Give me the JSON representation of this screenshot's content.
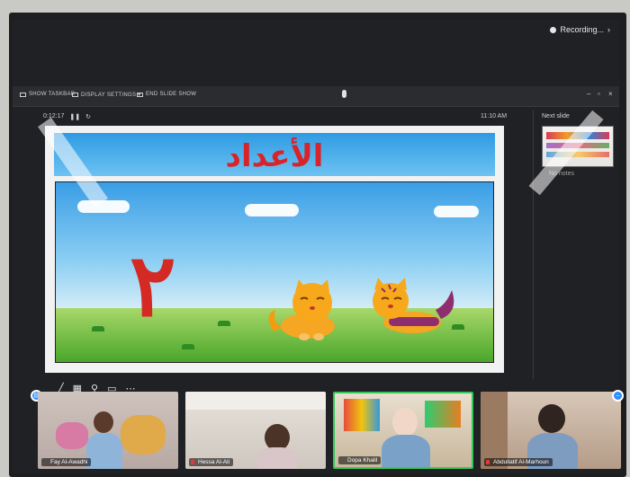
{
  "recording": {
    "label": "Recording..."
  },
  "toolbar": {
    "show_taskbar": "SHOW TASKBAR",
    "display_settings": "DISPLAY SETTINGS ▾",
    "end_slide_show": "END SLIDE SHOW"
  },
  "presenter": {
    "timer": "0:12:17",
    "clock": "11:10 AM",
    "next_slide_label": "Next slide",
    "notes_label": "No notes",
    "slide_title": "الأعداد",
    "numeral": "٢"
  },
  "participants": [
    {
      "name": "Fay Al-Awadhi",
      "muted": false
    },
    {
      "name": "Hessa Al-Ali",
      "muted": true
    },
    {
      "name": "Dopa Khalil",
      "muted": false,
      "active": true
    },
    {
      "name": "Abdullatif Al-Marhoun",
      "muted": true
    }
  ],
  "colors": {
    "accent": "#2d8cff",
    "active_speaker": "#34c759",
    "title_red": "#d8232a"
  }
}
